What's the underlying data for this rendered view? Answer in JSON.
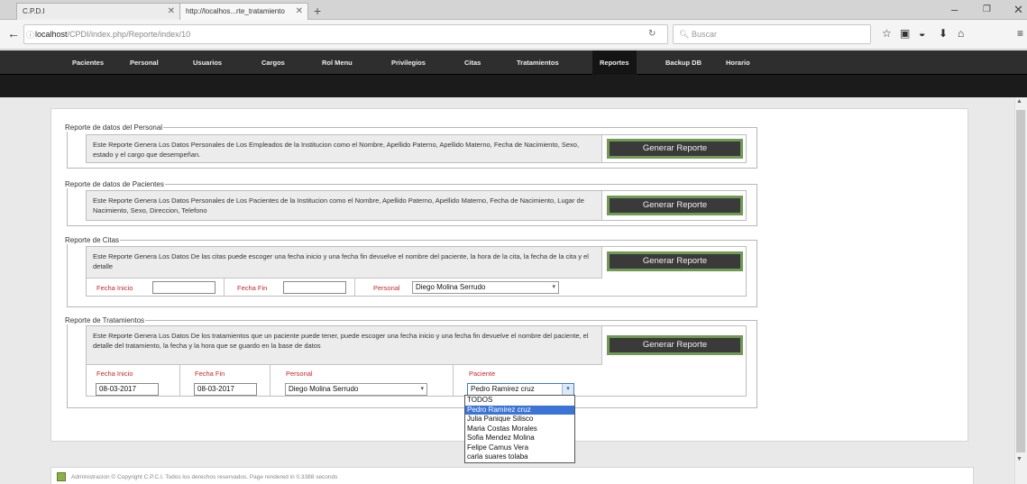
{
  "browser": {
    "tabs": [
      {
        "label": "C.P.D.I"
      },
      {
        "label": "http://localhos...rte_tratamiento"
      }
    ],
    "url_host": "localhost",
    "url_path": "/CPDI/index.php/Reporte/index/10",
    "search_placeholder": "Buscar",
    "icons": [
      "back-arrow-icon",
      "reload-icon",
      "search-icon",
      "star-icon",
      "reader-icon",
      "pocket-icon",
      "download-icon",
      "home-icon",
      "menu-icon"
    ]
  },
  "menu": {
    "items": [
      "Pacientes",
      "Personal",
      "Usuarios",
      "Cargos",
      "Rol Menu",
      "Privilegios",
      "Citas",
      "Tratamientos",
      "Reportes",
      "Backup DB",
      "Horario"
    ],
    "active": "Reportes"
  },
  "reports": {
    "personal": {
      "legend": "Reporte de datos del Personal",
      "desc": "Este Reporte Genera Los Datos Personales de Los Empleados de la Institucion como el Nombre, Apellido Paterno, Apellido Materno, Fecha de Nacimiento, Sexo, estado y el cargo que desempeñan.",
      "button": "Generar Reporte"
    },
    "pacientes": {
      "legend": "Reporte de datos de Pacientes",
      "desc": "Este Reporte Genera Los Datos Personales de Los Pacientes de la Institucion como el Nombre, Apellido Paterno, Apellido Materno, Fecha de Nacimiento, Lugar de Nacimiento, Sexo, Direccion, Telefono",
      "button": "Generar Reporte"
    },
    "citas": {
      "legend": "Reporte de Citas",
      "desc": "Este Reporte Genera Los Datos De las citas puede escoger una fecha inicio y una fecha fin devuelve el nombre del paciente, la hora de la cita, la fecha de la cita y el detalle",
      "button": "Generar Reporte",
      "fecha_inicio_label": "Fecha Inicio",
      "fecha_inicio_value": "",
      "fecha_fin_label": "Fecha Fin",
      "fecha_fin_value": "",
      "personal_label": "Personal",
      "personal_value": "Diego Molina Serrudo"
    },
    "tratamientos": {
      "legend": "Reporte de Tratamientos",
      "desc": "Este Reporte Genera Los Datos De los tratamientos que un paciente puede tener, puede escoger una fecha inicio y una fecha fin devuelve el nombre del paciente, el detalle del tratamiento, la fecha y la hora que se guardo en la base de datos",
      "button": "Generar Reporte",
      "fecha_inicio_label": "Fecha Inicio",
      "fecha_inicio_value": "08-03-2017",
      "fecha_fin_label": "Fecha Fin",
      "fecha_fin_value": "08-03-2017",
      "personal_label": "Personal",
      "personal_value": "Diego Molina Serrudo",
      "paciente_label": "Paciente",
      "paciente_value": "Pedro Ramirez cruz",
      "paciente_options": [
        "TODOS",
        "Pedro Ramirez cruz",
        "Julia Panique Silisco",
        "Maria Costas Morales",
        "Sofia Mendez Molina",
        "Felipe Camus Vera",
        "carla suares tolaba"
      ],
      "paciente_highlighted": "Pedro Ramirez cruz"
    }
  },
  "footer": {
    "text": "Administracion © Copyright C.P.C.I. Todos los derechos reservados. Page rendered in 0.3388 seconds"
  },
  "colors": {
    "menu_bg": "#2e2e2e",
    "button_bg": "#3a3a3a",
    "button_border": "#6f9b55",
    "label_red": "#c62828",
    "dropdown_highlight": "#3b74d6"
  }
}
